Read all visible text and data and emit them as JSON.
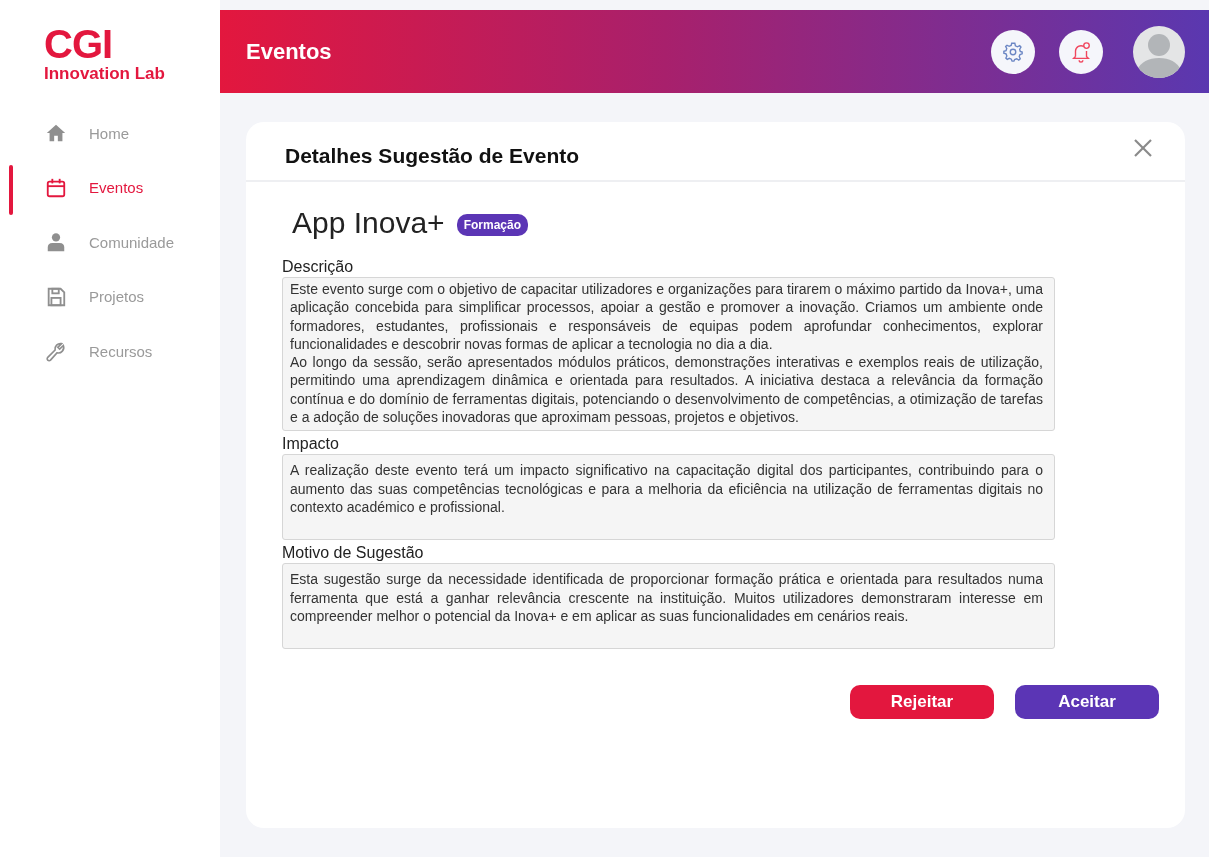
{
  "logo": {
    "mark": "CGI",
    "subtitle": "Innovation Lab"
  },
  "sidebar": {
    "items": [
      {
        "label": "Home",
        "selected": false
      },
      {
        "label": "Eventos",
        "selected": true
      },
      {
        "label": "Comunidade",
        "selected": false
      },
      {
        "label": "Projetos",
        "selected": false
      },
      {
        "label": "Recursos",
        "selected": false
      }
    ]
  },
  "header": {
    "title": "Eventos",
    "notification_unread": true
  },
  "dialog": {
    "title": "Detalhes Sugestão de Evento",
    "event_name": "App Inova+",
    "tag": "Formação",
    "fields": [
      {
        "label": "Descrição",
        "paragraphs": [
          "Este evento surge com o objetivo de capacitar utilizadores e organizações para tirarem o máximo partido da Inova+, uma aplicação concebida para simplificar processos, apoiar a gestão e promover a inovação. Criamos um ambiente onde formadores, estudantes, profissionais e responsáveis de equipas podem aprofundar conhecimentos, explorar funcionalidades e descobrir novas formas de aplicar a tecnologia no dia a dia.",
          "Ao longo da sessão, serão apresentados módulos práticos, demonstrações interativas e exemplos reais de utilização, permitindo uma aprendizagem dinâmica e orientada para resultados. A iniciativa destaca a relevância da formação contínua e do domínio de ferramentas digitais, potenciando o desenvolvimento de competências, a otimização de tarefas e a adoção de soluções inovadoras que aproximam pessoas, projetos e objetivos."
        ]
      },
      {
        "label": "Impacto",
        "paragraphs": [
          "A realização deste evento terá um impacto significativo na capacitação digital dos participantes, contribuindo para o aumento das suas competências tecnológicas e para a melhoria da eficiência na utilização de ferramentas digitais no contexto académico e profissional."
        ]
      },
      {
        "label": "Motivo de Sugestão",
        "paragraphs": [
          "Esta sugestão surge da necessidade identificada de proporcionar formação prática e orientada para resultados numa ferramenta que está a ganhar relevância crescente na instituição. Muitos utilizadores demonstraram interesse em compreender melhor o potencial da Inova+ e em aplicar as suas funcionalidades em cenários reais."
        ]
      }
    ],
    "buttons": [
      {
        "label": "Rejeitar",
        "kind": "reject"
      },
      {
        "label": "Aceitar",
        "kind": "accept"
      }
    ]
  }
}
